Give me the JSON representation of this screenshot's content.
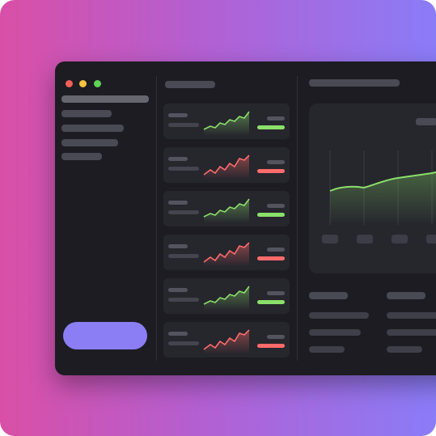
{
  "window": {
    "controls": [
      "close-dot",
      "minimize-dot",
      "zoom-dot"
    ],
    "colors": {
      "close": "#f25f57",
      "minimize": "#f5c33f",
      "zoom": "#5fd354"
    }
  },
  "colors": {
    "up": "#8be06a",
    "down": "#ff6b6b",
    "accent": "#8b7ef5"
  },
  "list": {
    "trends": [
      "up",
      "down",
      "up",
      "down",
      "up",
      "down"
    ]
  },
  "main_chart": {
    "trend": "up",
    "x_chip_count": 4
  }
}
